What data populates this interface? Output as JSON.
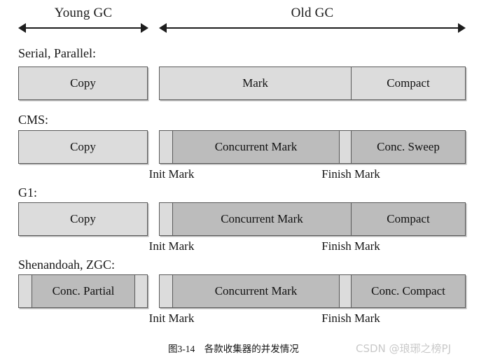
{
  "figure": {
    "caption": "图3-14　各款收集器的并发情况",
    "watermark": "CSDN @琅琊之榜PJ"
  },
  "palette": {
    "light_gray": "#dcdcdc",
    "medium_gray": "#bcbcbc",
    "border": "#5a5a5a",
    "text": "#111111",
    "watermark": "#c9c9c9"
  },
  "header": {
    "phases": [
      {
        "label": "Young GC",
        "arrow": "double-headed-arrow"
      },
      {
        "label": "Old GC",
        "arrow": "double-headed-arrow"
      }
    ]
  },
  "rows": [
    {
      "title": "Serial, Parallel:",
      "young": {
        "segments": [
          {
            "label": "Copy",
            "shade": "light"
          }
        ]
      },
      "old": {
        "segments": [
          {
            "label": "Mark",
            "shade": "light"
          },
          {
            "label": "Compact",
            "shade": "light"
          }
        ]
      },
      "pause_labels": []
    },
    {
      "title": "CMS:",
      "young": {
        "segments": [
          {
            "label": "Copy",
            "shade": "light"
          }
        ]
      },
      "old": {
        "segments": [
          {
            "label": "",
            "shade": "light"
          },
          {
            "label": "Concurrent Mark",
            "shade": "medium"
          },
          {
            "label": "",
            "shade": "light"
          },
          {
            "label": "Conc. Sweep",
            "shade": "medium"
          }
        ]
      },
      "pause_labels": [
        {
          "label": "Init Mark"
        },
        {
          "label": "Finish Mark"
        }
      ]
    },
    {
      "title": "G1:",
      "young": {
        "segments": [
          {
            "label": "Copy",
            "shade": "light"
          }
        ]
      },
      "old": {
        "segments": [
          {
            "label": "",
            "shade": "light"
          },
          {
            "label": "Concurrent Mark",
            "shade": "medium"
          },
          {
            "label": "Compact",
            "shade": "medium"
          }
        ]
      },
      "pause_labels": [
        {
          "label": "Init Mark"
        },
        {
          "label": "Finish Mark"
        }
      ]
    },
    {
      "title": "Shenandoah, ZGC:",
      "young": {
        "segments": [
          {
            "label": "",
            "shade": "light"
          },
          {
            "label": "Conc. Partial",
            "shade": "medium"
          },
          {
            "label": "",
            "shade": "light"
          }
        ]
      },
      "old": {
        "segments": [
          {
            "label": "",
            "shade": "light"
          },
          {
            "label": "Concurrent Mark",
            "shade": "medium"
          },
          {
            "label": "",
            "shade": "light"
          },
          {
            "label": "Conc. Compact",
            "shade": "medium"
          }
        ]
      },
      "pause_labels": [
        {
          "label": "Init Mark"
        },
        {
          "label": "Finish Mark"
        }
      ]
    }
  ]
}
